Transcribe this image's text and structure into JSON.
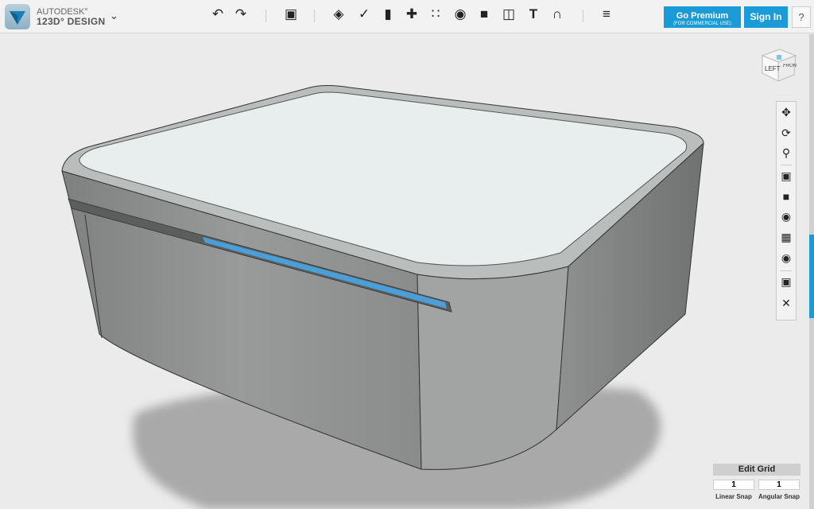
{
  "app": {
    "brand_top": "AUTODESK°",
    "brand_name": "123D° DESIGN"
  },
  "toolbar": {
    "undo": "↶",
    "redo": "↷",
    "text_tool": "T"
  },
  "header": {
    "premium_label": "Go Premium",
    "premium_sub": "(FOR COMMERCIAL USE)",
    "signin_label": "Sign In",
    "help_label": "?"
  },
  "viewcube": {
    "left": "LEFT",
    "front": "FRONT"
  },
  "grid": {
    "title": "Edit Grid",
    "linear_value": "1",
    "angular_value": "1",
    "linear_label": "Linear Snap",
    "angular_label": "Angular Snap"
  },
  "colors": {
    "accent": "#1a9ad6",
    "slot": "#4a9fd8"
  }
}
